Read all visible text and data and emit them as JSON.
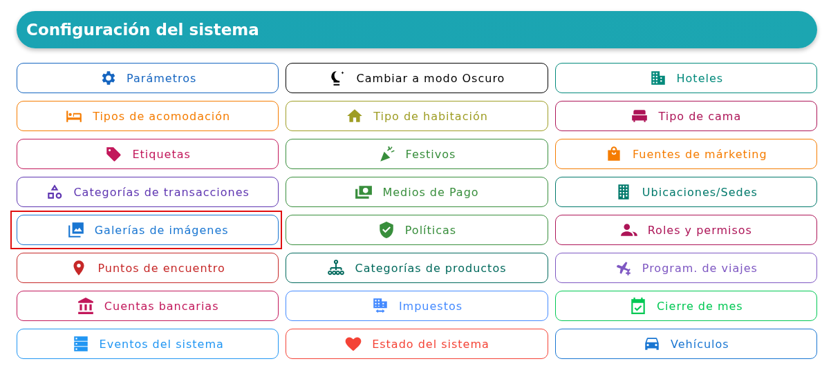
{
  "header": {
    "title": "Configuración del sistema"
  },
  "items": [
    {
      "label": "Parámetros",
      "color": "#1565c0",
      "selected": false
    },
    {
      "label": "Cambiar a modo Oscuro",
      "color": "#000000",
      "selected": false
    },
    {
      "label": "Hoteles",
      "color": "#00897b",
      "selected": false
    },
    {
      "label": "Tipos de acomodación",
      "color": "#f57c00",
      "selected": false
    },
    {
      "label": "Tipo de habitación",
      "color": "#9e9d24",
      "selected": false
    },
    {
      "label": "Tipo de cama",
      "color": "#ad1457",
      "selected": false
    },
    {
      "label": "Etiquetas",
      "color": "#c2185b",
      "selected": false
    },
    {
      "label": "Festivos",
      "color": "#388e3c",
      "selected": false
    },
    {
      "label": "Fuentes de márketing",
      "color": "#f57c00",
      "selected": false
    },
    {
      "label": "Categorías de transacciones",
      "color": "#5e35b1",
      "selected": false
    },
    {
      "label": "Medios de Pago",
      "color": "#388e3c",
      "selected": false
    },
    {
      "label": "Ubicaciones/Sedes",
      "color": "#00796b",
      "selected": false
    },
    {
      "label": "Galerías de imágenes",
      "color": "#1976d2",
      "selected": true
    },
    {
      "label": "Políticas",
      "color": "#388e3c",
      "selected": false
    },
    {
      "label": "Roles y permisos",
      "color": "#ad1457",
      "selected": false
    },
    {
      "label": "Puntos de encuentro",
      "color": "#c62828",
      "selected": false
    },
    {
      "label": "Categorías de productos",
      "color": "#00695c",
      "selected": false
    },
    {
      "label": "Program. de viajes",
      "color": "#7e57c2",
      "selected": false
    },
    {
      "label": "Cuentas bancarias",
      "color": "#c2185b",
      "selected": false
    },
    {
      "label": "Impuestos",
      "color": "#448aff",
      "selected": false
    },
    {
      "label": "Cierre de mes",
      "color": "#00c853",
      "selected": false
    },
    {
      "label": "Eventos del sistema",
      "color": "#2196f3",
      "selected": false
    },
    {
      "label": "Estado del sistema",
      "color": "#f44336",
      "selected": false
    },
    {
      "label": "Vehículos",
      "color": "#1976d2",
      "selected": false
    }
  ]
}
